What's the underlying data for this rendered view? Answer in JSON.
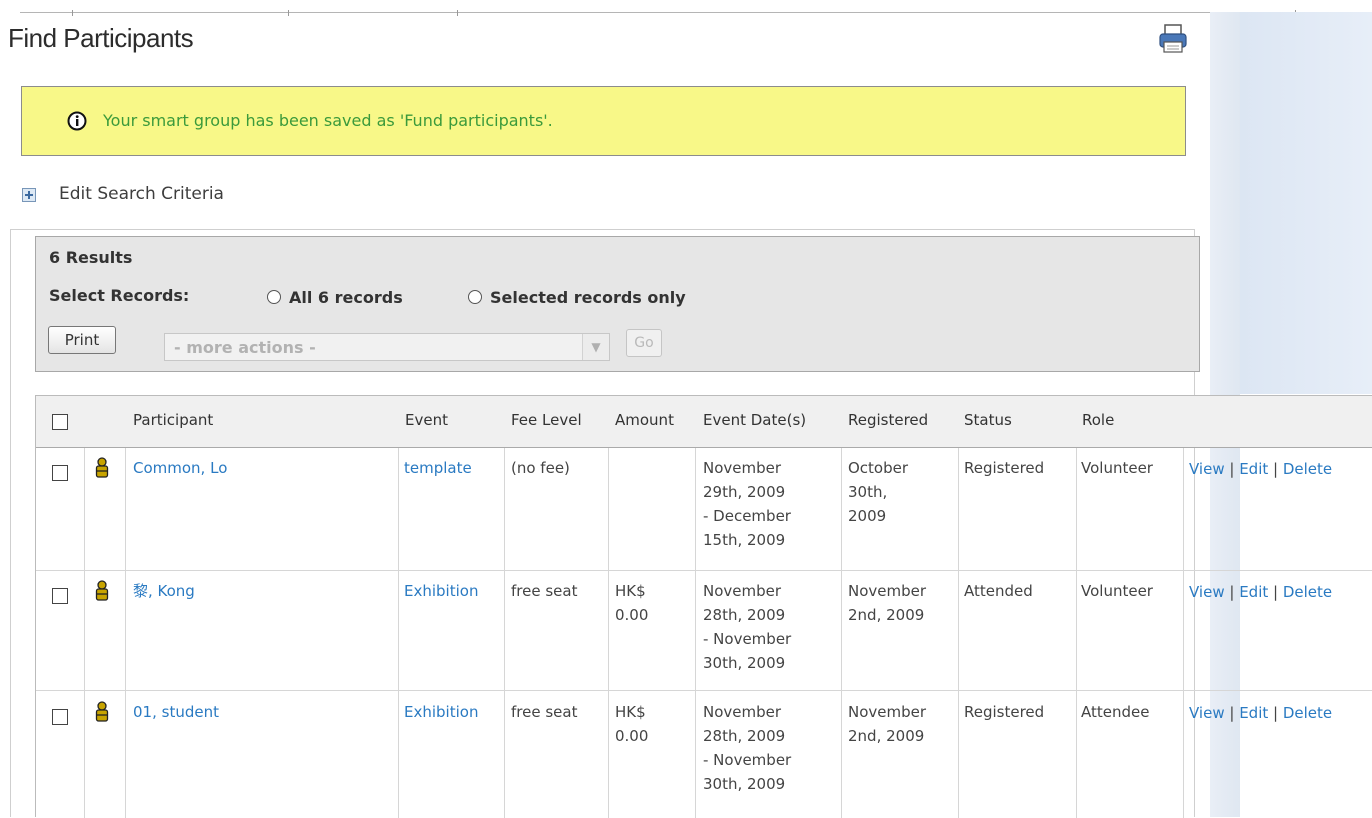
{
  "page": {
    "title": "Find Participants",
    "print_icon": "printer-icon"
  },
  "message": {
    "icon": "info-icon",
    "text": "Your smart group has been saved as 'Fund participants'."
  },
  "criteria": {
    "icon": "expand-plus-icon",
    "label": "Edit Search Criteria"
  },
  "results": {
    "count_label": "6 Results",
    "select_label": "Select Records:",
    "option_all": "All 6 records",
    "option_selected": "Selected records only",
    "print_button": "Print",
    "actions_placeholder": "- more actions -",
    "go_button": "Go"
  },
  "table": {
    "headers": [
      "Participant",
      "Event",
      "Fee Level",
      "Amount",
      "Event Date(s)",
      "Registered",
      "Status",
      "Role"
    ],
    "rows": [
      {
        "participant": "Common, Lo",
        "event": "template",
        "fee_level": "(no fee)",
        "amount": [
          "",
          ""
        ],
        "event_dates": [
          "November",
          "29th, 2009",
          "- December",
          "15th, 2009"
        ],
        "registered": [
          "October",
          "30th,",
          "2009"
        ],
        "status": "Registered",
        "role": "Volunteer",
        "actions": [
          "View",
          "Edit",
          "Delete"
        ]
      },
      {
        "participant": "黎, Kong",
        "event": "Exhibition",
        "fee_level": "free seat",
        "amount": [
          "HK$",
          "0.00"
        ],
        "event_dates": [
          "November",
          "28th, 2009",
          "- November",
          "30th, 2009"
        ],
        "registered": [
          "November",
          "2nd, 2009",
          ""
        ],
        "status": "Attended",
        "role": "Volunteer",
        "actions": [
          "View",
          "Edit",
          "Delete"
        ]
      },
      {
        "participant": "01, student",
        "event": "Exhibition",
        "fee_level": "free seat",
        "amount": [
          "HK$",
          "0.00"
        ],
        "event_dates": [
          "November",
          "28th, 2009",
          "- November",
          "30th, 2009"
        ],
        "registered": [
          "November",
          "2nd, 2009",
          ""
        ],
        "status": "Registered",
        "role": "Attendee",
        "actions": [
          "View",
          "Edit",
          "Delete"
        ]
      }
    ]
  },
  "colors": {
    "link": "#2a7ac2",
    "message_bg": "#f8f888",
    "message_text": "#3b9a3b"
  }
}
